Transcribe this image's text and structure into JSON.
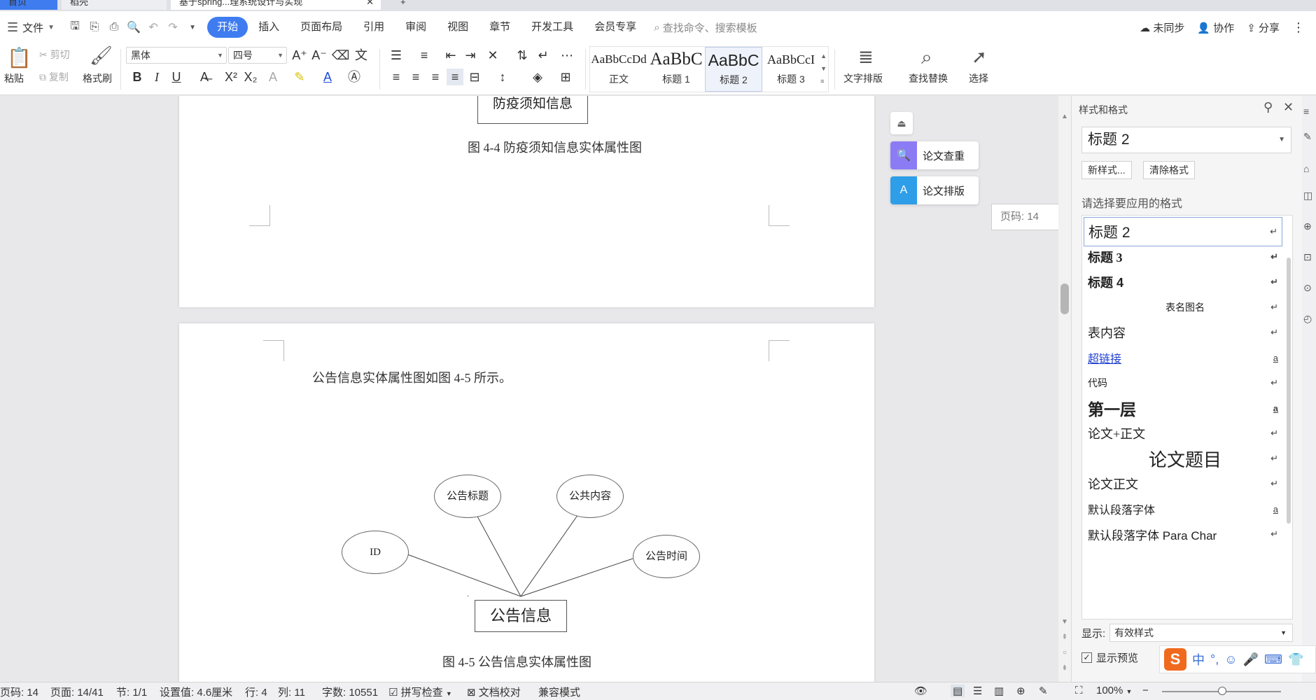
{
  "titlebar": {
    "tab_home": "首页",
    "tab_daoke": "稻壳",
    "tab_doc": "基于spring...理系统设计与实现",
    "tab_close": "✕",
    "tab_add": "+"
  },
  "menu": {
    "file": "文件",
    "tabs": [
      "开始",
      "插入",
      "页面布局",
      "引用",
      "审阅",
      "视图",
      "章节",
      "开发工具",
      "会员专享"
    ],
    "search_placeholder": "查找命令、搜索模板",
    "unsynced": "未同步",
    "collab": "协作",
    "share": "分享"
  },
  "ribbon": {
    "paste": "粘贴",
    "cut": "剪切",
    "copy": "复制",
    "format_painter": "格式刷",
    "font_name": "黑体",
    "font_size": "四号",
    "bold": "B",
    "italic": "I",
    "underline": "U",
    "styles": [
      {
        "preview": "AaBbCcDd",
        "label": "正文"
      },
      {
        "preview": "AaBbC",
        "label": "标题 1"
      },
      {
        "preview": "AaBbC",
        "label": "标题 2"
      },
      {
        "preview": "AaBbCcI",
        "label": "标题 3"
      }
    ],
    "text_layout": "文字排版",
    "find_replace": "查找替换",
    "select": "选择"
  },
  "doc": {
    "page1": {
      "entity": "防疫须知信息",
      "caption": "图 4-4 防疫须知信息实体属性图"
    },
    "page2": {
      "intro": "公告信息实体属性图如图 4-5 所示。",
      "entity": "公告信息",
      "attr_title": "公告标题",
      "attr_content": "公共内容",
      "attr_id": "ID",
      "attr_time": "公告时间",
      "caption": "图 4-5 公告信息实体属性图"
    }
  },
  "floating": {
    "check": "论文查重",
    "layout": "论文排版",
    "page_tip": "页码: 14"
  },
  "pane": {
    "title": "样式和格式",
    "current_style": "标题 2",
    "new_style": "新样式...",
    "clear_format": "清除格式",
    "apply_label": "请选择要应用的格式",
    "items": [
      {
        "name": "标题 2",
        "mark": "↵"
      },
      {
        "name": "标题 3",
        "mark": "↵"
      },
      {
        "name": "标题 4",
        "mark": "↵"
      },
      {
        "name": "表名图名",
        "mark": "↵"
      },
      {
        "name": "表内容",
        "mark": "↵"
      },
      {
        "name": "超链接",
        "mark": "a"
      },
      {
        "name": "代码",
        "mark": "↵"
      },
      {
        "name": "第一层",
        "mark": "a"
      },
      {
        "name": "论文+正文",
        "mark": "↵"
      },
      {
        "name": "论文题目",
        "mark": "↵"
      },
      {
        "name": "论文正文",
        "mark": "↵"
      },
      {
        "name": "默认段落字体",
        "mark": "a"
      },
      {
        "name": "默认段落字体 Para Char",
        "mark": "↵"
      }
    ],
    "show_label": "显示:",
    "show_value": "有效样式",
    "preview_label": "显示预览"
  },
  "ime": {
    "logo": "S",
    "lang": "中",
    "punct": "°,",
    "emoji": "☺",
    "mic": "🎤",
    "keyboard": "⌨",
    "skin": "👕"
  },
  "status": {
    "page_num": "页码: 14",
    "page": "页面: 14/41",
    "section": "节: 1/1",
    "setting": "设置值: 4.6厘米",
    "row": "行: 4",
    "col": "列: 11",
    "words": "字数: 10551",
    "spell": "拼写检查",
    "proof": "文档校对",
    "compat": "兼容模式",
    "zoom": "100%"
  },
  "colors": {
    "accent": "#3e7cf0",
    "check_icon": "#8b7cf6",
    "layout_icon": "#2f9ee8",
    "ime_logo": "#f06a1d"
  }
}
